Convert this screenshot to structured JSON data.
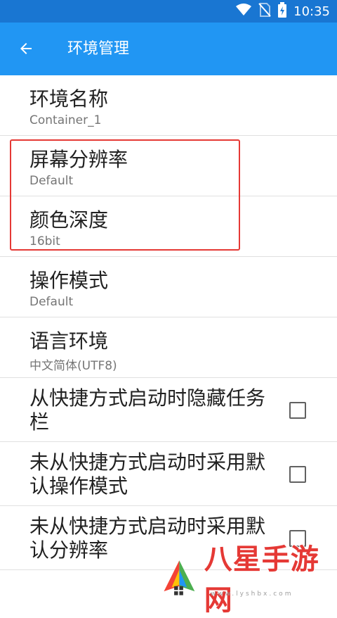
{
  "status_bar": {
    "time": "10:35",
    "icons": [
      "wifi-icon",
      "no-sim-icon",
      "battery-charging-icon"
    ]
  },
  "app_bar": {
    "title": "环境管理",
    "back_icon": "arrow-back-icon"
  },
  "settings": [
    {
      "title": "环境名称",
      "subtitle": "Container_1"
    },
    {
      "title": "屏幕分辨率",
      "subtitle": "Default"
    },
    {
      "title": "颜色深度",
      "subtitle": "16bit"
    },
    {
      "title": "操作模式",
      "subtitle": "Default"
    },
    {
      "title": "语言环境",
      "subtitle": "中文简体(UTF8)"
    }
  ],
  "checkbox_settings": [
    {
      "title": "从快捷方式启动时隐藏任务栏",
      "checked": false
    },
    {
      "title": "未从快捷方式启动时采用默认操作模式",
      "checked": false
    },
    {
      "title": "未从快捷方式启动时采用默认分辨率",
      "checked": false
    }
  ],
  "watermark": {
    "text": "八星手游网",
    "url": "www.lyshbx.com"
  },
  "colors": {
    "status_bar": "#1976d2",
    "app_bar": "#2196f3",
    "highlight": "#e53935"
  }
}
